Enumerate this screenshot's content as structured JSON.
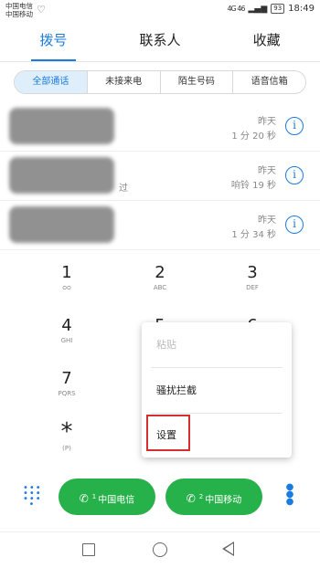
{
  "status_bar": {
    "carrier1": "中国电信",
    "carrier2": "中国移动",
    "signal": "4G 46",
    "battery": "93",
    "time": "18:49"
  },
  "tabs": [
    {
      "label": "拨号",
      "active": true
    },
    {
      "label": "联系人",
      "active": false
    },
    {
      "label": "收藏",
      "active": false
    }
  ],
  "filters": [
    {
      "label": "全部通话",
      "active": true
    },
    {
      "label": "未接来电",
      "active": false
    },
    {
      "label": "陌生号码",
      "active": false
    },
    {
      "label": "语音信箱",
      "active": false
    }
  ],
  "call_log": [
    {
      "subtitle": "",
      "time": "昨天",
      "detail": "1 分 20 秒"
    },
    {
      "subtitle": "过",
      "time": "昨天",
      "detail": "响铃 19 秒"
    },
    {
      "subtitle": "",
      "time": "昨天",
      "detail": "1 分 34 秒"
    }
  ],
  "dialpad": {
    "keys": [
      {
        "digit": "1",
        "letters": "ᴑᴑ"
      },
      {
        "digit": "2",
        "letters": "ABC"
      },
      {
        "digit": "3",
        "letters": "DEF"
      },
      {
        "digit": "4",
        "letters": "GHI"
      },
      {
        "digit": "5",
        "letters": ""
      },
      {
        "digit": "6",
        "letters": ""
      },
      {
        "digit": "7",
        "letters": "PQRS"
      },
      {
        "digit": "*",
        "letters": "(P)"
      }
    ]
  },
  "menu": {
    "items": [
      {
        "label": "粘贴",
        "enabled": false
      },
      {
        "label": "骚扰拦截",
        "enabled": true
      },
      {
        "label": "设置",
        "enabled": true,
        "highlighted": true
      }
    ]
  },
  "bottom_bar": {
    "sim1_label": "中国电信",
    "sim1_number": "1",
    "sim2_label": "中国移动",
    "sim2_number": "2",
    "phone_glyph": "✆",
    "dialpad_icon": "dialpad-icon",
    "more_icon": "more-vert-icon"
  },
  "colors": {
    "accent": "#1a7be0",
    "call_green": "#27b14a",
    "highlight_red": "#d32f2f"
  }
}
